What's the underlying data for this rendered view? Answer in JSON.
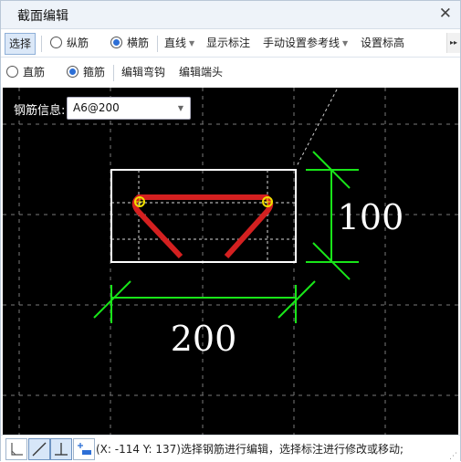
{
  "window": {
    "title": "截面编辑"
  },
  "toolbar1": {
    "select_label": "选择",
    "radio_longitudinal": "纵筋",
    "radio_transverse": "横筋",
    "line_dropdown": "直线",
    "show_annotation": "显示标注",
    "manual_reference": "手动设置参考线",
    "set_elevation": "设置标高"
  },
  "toolbar2": {
    "radio_straight": "直筋",
    "radio_stirrup": "箍筋",
    "edit_hook": "编辑弯钩",
    "edit_end": "编辑端头"
  },
  "canvas": {
    "rebar_info_label": "钢筋信息:",
    "rebar_info_value": "A6@200",
    "dim_width": "200",
    "dim_height": "100"
  },
  "status": {
    "message": "(X: -114 Y: 137)选择钢筋进行编辑，选择标注进行修改或移动;"
  },
  "colors": {
    "canvas_bg": "#000000",
    "rebar": "#d42020",
    "dimension": "#19e619",
    "outline": "#ffffff",
    "node": "#f0e000"
  },
  "icons": [
    "close-icon",
    "more-icon",
    "corner-line-icon",
    "diagonal-line-icon",
    "perpendicular-icon",
    "add-dimension-icon",
    "resize-grip-icon"
  ]
}
